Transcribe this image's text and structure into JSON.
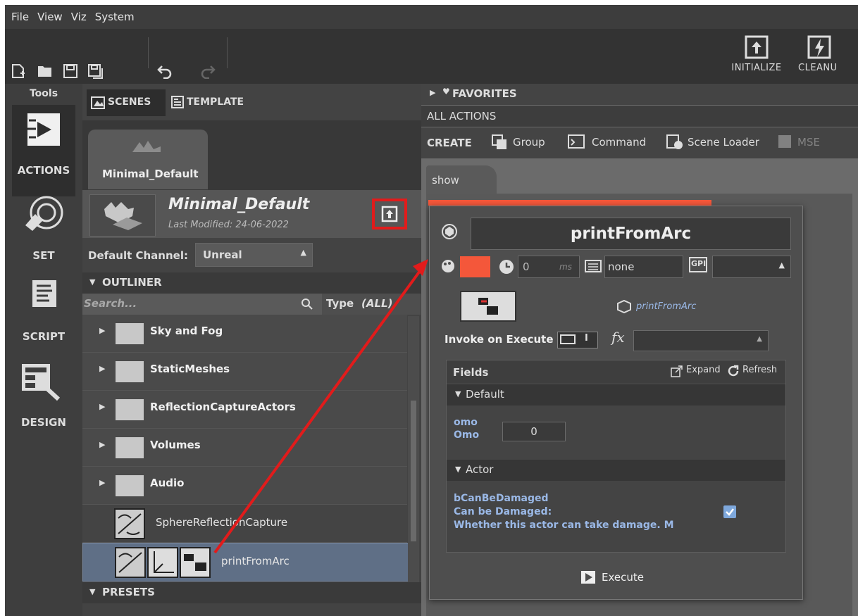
{
  "menu": [
    "File",
    "View",
    "Viz",
    "System"
  ],
  "toolbar": {
    "initialize": "INITIALIZE",
    "cleanup": "CLEANU"
  },
  "tools": {
    "header": "Tools",
    "actions": "ACTIONS",
    "set": "SET",
    "script": "SCRIPT",
    "design": "DESIGN"
  },
  "scenes": {
    "tab_scenes": "SCENES",
    "tab_template": "TEMPLATE",
    "scene_tab": "Minimal_Default",
    "scene_name": "Minimal_Default",
    "last_modified": "Last Modified: 24-06-2022",
    "default_channel_label": "Default Channel:",
    "default_channel_value": "Unreal",
    "outliner": "OUTLINER",
    "search_placeholder": "Search...",
    "type_filter": "Type",
    "type_value": "(ALL)",
    "folders": [
      "Sky and Fog",
      "StaticMeshes",
      "ReflectionCaptureActors",
      "Volumes",
      "Audio"
    ],
    "items": [
      "SphereReflectionCapture",
      "printFromArc"
    ],
    "presets": "PRESETS"
  },
  "right": {
    "favorites": "FAVORITES",
    "all_actions": "ALL ACTIONS",
    "create": "CREATE",
    "create_buttons": [
      "Group",
      "Command",
      "Scene Loader",
      "MSE"
    ],
    "tab": "show"
  },
  "popup": {
    "title": "printFromArc",
    "delay_value": "0",
    "delay_unit": "ms",
    "trigger_value": "none",
    "gpi_label": "GPI",
    "action_name": "printFromArc",
    "invoke_label": "Invoke on Execute",
    "toggle_state": "I",
    "fx": "fx",
    "fields": "Fields",
    "expand": "Expand",
    "refresh": "Refresh",
    "group_default": "Default",
    "omo_label1": "omo",
    "omo_label2": "Omo",
    "omo_value": "0",
    "group_actor": "Actor",
    "bcan1": "bCanBeDamaged",
    "bcan2": "Can be Damaged:",
    "bcan3": "Whether this actor can take damage. M",
    "execute": "Execute"
  },
  "colors": {
    "accent": "#f4573a",
    "highlight": "#e02020"
  }
}
